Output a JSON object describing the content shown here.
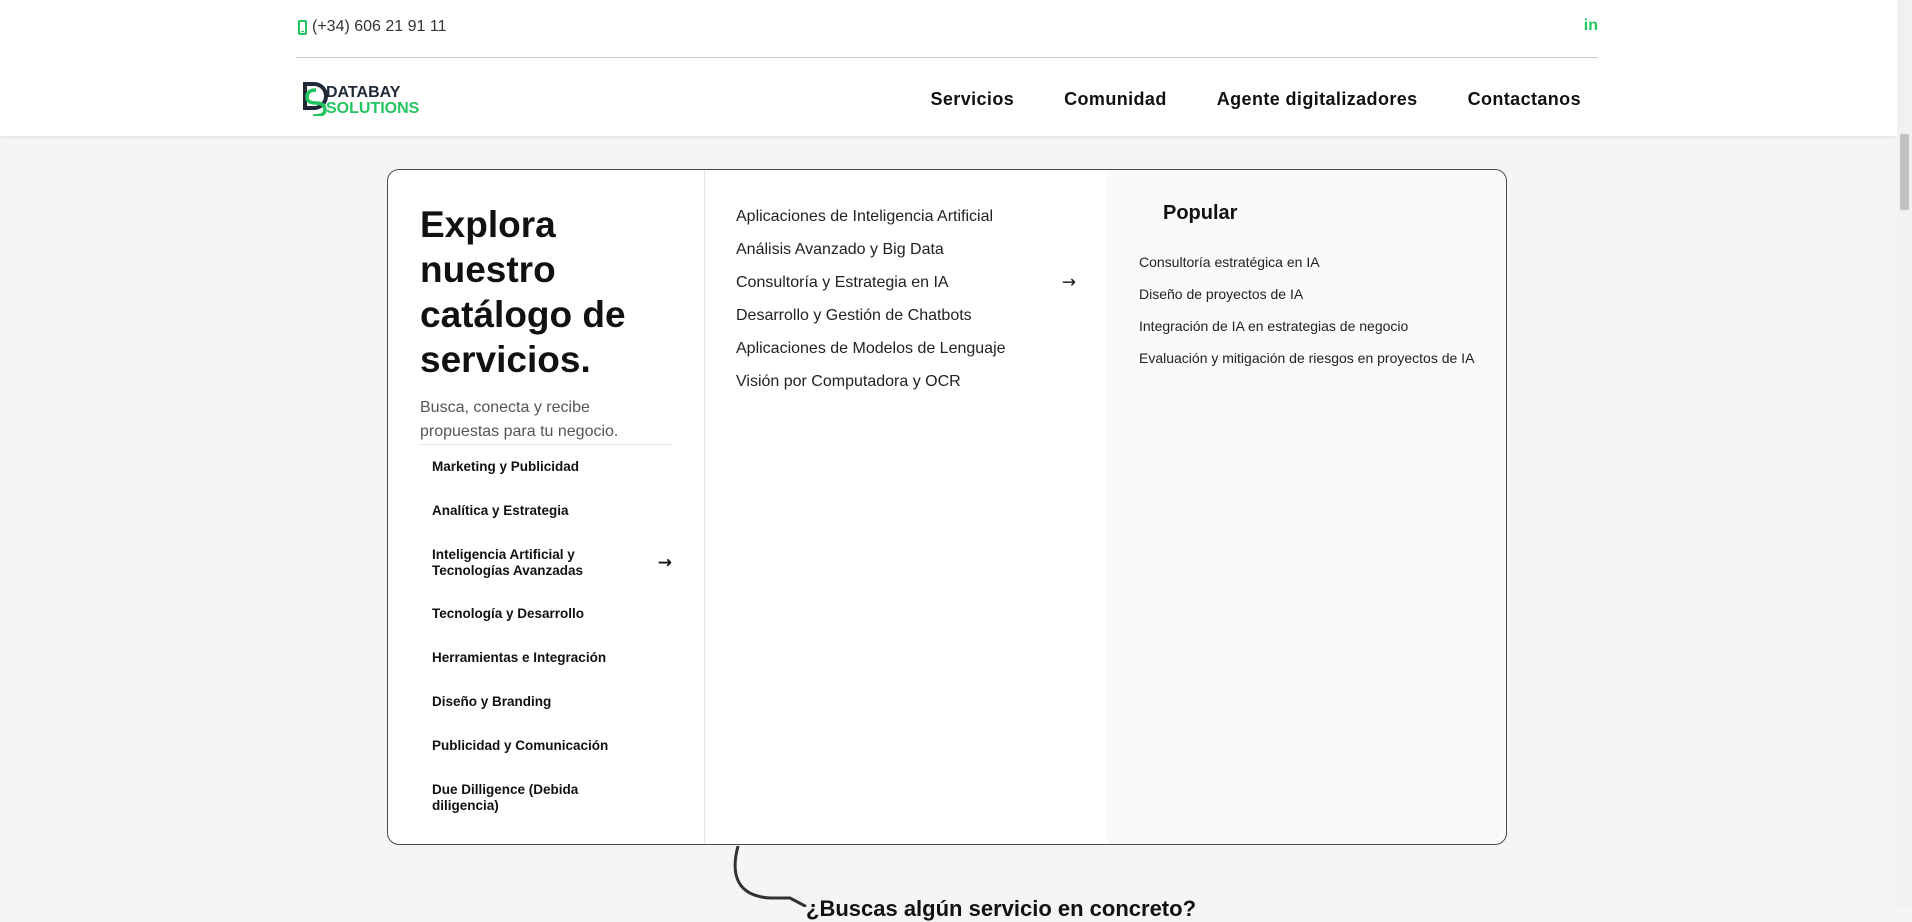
{
  "topbar": {
    "phone": "(+34) 606 21 91 11",
    "social_icon": "in"
  },
  "logo": {
    "line1": "DATABAY",
    "line2": "SOLUTIONS",
    "colors": {
      "dark": "#1f2937",
      "accent": "#22c55e"
    }
  },
  "nav": {
    "items": [
      "Servicios",
      "Comunidad",
      "Agente digitalizadores",
      "Contactanos"
    ]
  },
  "menu": {
    "title": "Explora nuestro catálogo de servicios.",
    "subtitle": "Busca, conecta y recibe propuestas para tu negocio.",
    "categories": [
      "Marketing y Publicidad",
      "Analítica y Estrategia",
      "Inteligencia Artificial y Tecnologías Avanzadas",
      "Tecnología y Desarrollo",
      "Herramientas e Integración",
      "Diseño y Branding",
      "Publicidad y Comunicación",
      "Due Dilligence (Debida diligencia)"
    ],
    "active_category_arrow": "→",
    "subcategories": [
      "Aplicaciones de Inteligencia Artificial",
      "Análisis Avanzado y Big Data",
      "Consultoría y Estrategia en IA",
      "Desarrollo y Gestión de Chatbots",
      "Aplicaciones de Modelos de Lenguaje",
      "Visión por Computadora y OCR"
    ],
    "active_subcategory_arrow": "→",
    "popular_title": "Popular",
    "popular": [
      "Consultoría estratégica en IA",
      "Diseño de proyectos de IA",
      "Integración de IA en estrategias de negocio",
      "Evaluación y mitigación de riesgos en proyectos de IA"
    ]
  },
  "teaser": "¿Buscas algún servicio en concreto?",
  "colors": {
    "accent": "#22c55e",
    "background": "#f7f5f3",
    "border": "#4a4a4a"
  }
}
